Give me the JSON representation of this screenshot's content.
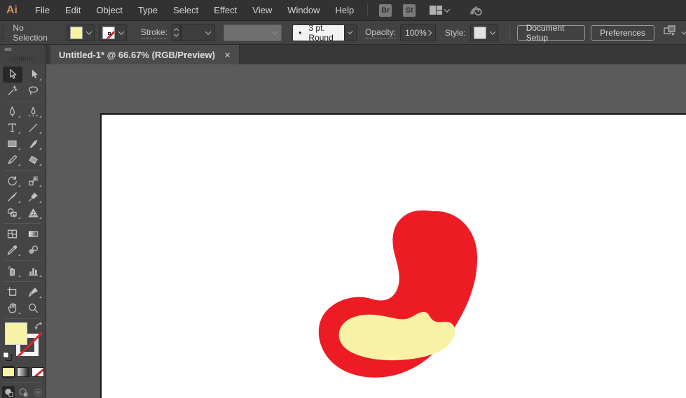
{
  "menubar": {
    "logo": "Ai",
    "menus": [
      "File",
      "Edit",
      "Object",
      "Type",
      "Select",
      "Effect",
      "View",
      "Window",
      "Help"
    ],
    "bridge_label": "Br",
    "stock_label": "St"
  },
  "controlbar": {
    "selection_status": "No Selection",
    "fill_color": "#f8f2a6",
    "stroke_swatch": "none",
    "stroke_label": "Stroke:",
    "brush_bullet": "•",
    "brush_value": "3 pt. Round",
    "opacity_label": "Opacity:",
    "opacity_value": "100%",
    "style_label": "Style:",
    "document_setup_label": "Document Setup",
    "preferences_label": "Preferences"
  },
  "tabbar": {
    "collapse_glyph": "««",
    "tab_title": "Untitled-1* @ 66.67% (RGB/Preview)",
    "close_glyph": "×"
  },
  "toolbar": {
    "active_tool": "selection",
    "rows": [
      [
        "selection",
        "direct-selection"
      ],
      [
        "magic-wand",
        "lasso"
      ],
      "sep",
      [
        "pen",
        "curvature"
      ],
      [
        "type",
        "line-segment"
      ],
      [
        "rectangle",
        "paintbrush"
      ],
      [
        "pencil",
        "eraser"
      ],
      "sep",
      [
        "rotate",
        "scale"
      ],
      [
        "width",
        "puppet-warp"
      ],
      [
        "shape-builder",
        "perspective-grid"
      ],
      "sep",
      [
        "mesh",
        "gradient"
      ],
      [
        "eyedropper",
        "blend"
      ],
      "sep",
      [
        "symbol-sprayer",
        "column-graph"
      ],
      "sep",
      [
        "artboard",
        "slice"
      ],
      [
        "hand",
        "zoom"
      ],
      "sep"
    ],
    "fill_color": "#f8f2a6",
    "stroke_state": "none",
    "drawing_modes": [
      "draw-normal",
      "draw-behind",
      "draw-inside"
    ],
    "active_drawing_mode": "draw-normal"
  },
  "canvas": {
    "artboard_color": "#ffffff",
    "shape_fill": "#ed1c24",
    "blob_fill": "#f8f2a6"
  }
}
